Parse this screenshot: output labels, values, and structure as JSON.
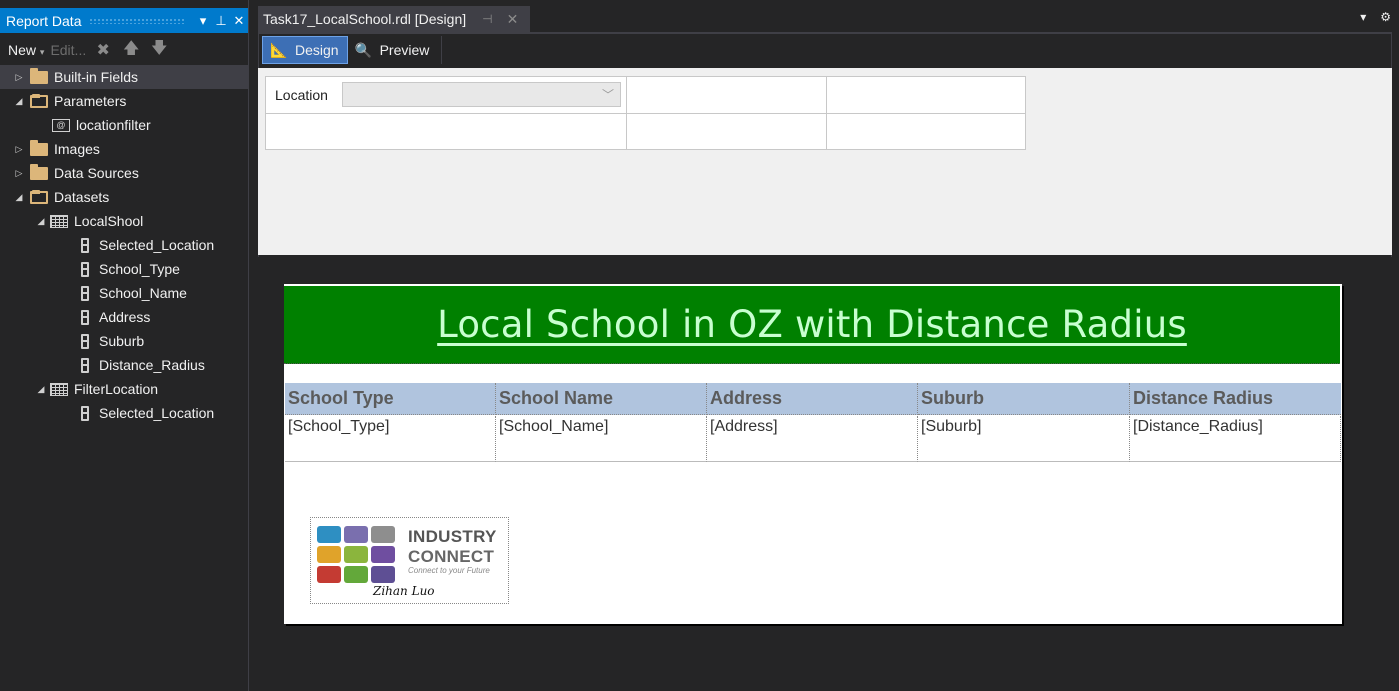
{
  "report_data": {
    "title": "Report Data",
    "toolbar": {
      "new_label": "New",
      "edit_label": "Edit..."
    },
    "tree": {
      "builtin": "Built-in Fields",
      "parameters": "Parameters",
      "param_items": [
        "locationfilter"
      ],
      "images": "Images",
      "data_sources": "Data Sources",
      "datasets": "Datasets",
      "dataset1": {
        "name": "LocalShool",
        "fields": [
          "Selected_Location",
          "School_Type",
          "School_Name",
          "Address",
          "Suburb",
          "Distance_Radius"
        ]
      },
      "dataset2": {
        "name": "FilterLocation",
        "fields": [
          "Selected_Location"
        ]
      }
    }
  },
  "document": {
    "tab_title": "Task17_LocalSchool.rdl [Design]",
    "view_tabs": {
      "design": "Design",
      "preview": "Preview"
    }
  },
  "parameters_pane": {
    "location_label": "Location",
    "location_value": ""
  },
  "report": {
    "title": "Local School in OZ with Distance Radius",
    "title_band_color": "#008000",
    "header_color": "#b0c4de",
    "columns": [
      "School Type",
      "School Name",
      "Address",
      "Suburb",
      "Distance Radius"
    ],
    "row_expressions": [
      "[School_Type]",
      "[School_Name]",
      "[Address]",
      "[Suburb]",
      "[Distance_Radius]"
    ],
    "logo": {
      "line1": "INDUSTRY",
      "line2": "CONNECT",
      "tagline": "Connect to your Future",
      "signature": "Zihan Luo"
    }
  }
}
